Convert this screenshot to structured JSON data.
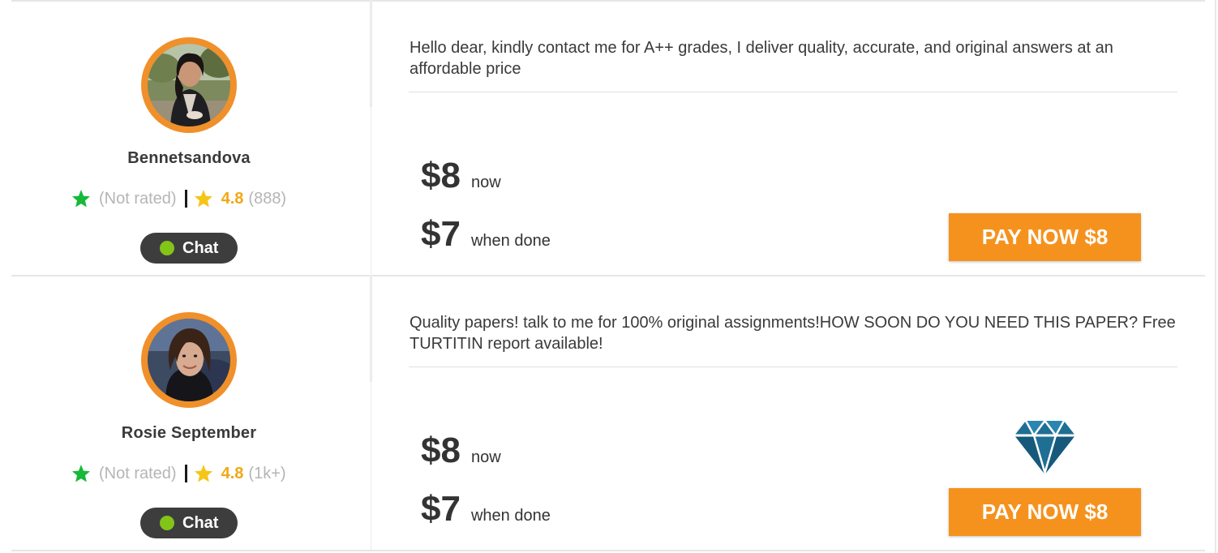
{
  "bids": [
    {
      "writer": {
        "name": "Bennetsandova",
        "avatar": "writer-photo-woman-dark-hair"
      },
      "rating": {
        "first_label": "(Not rated)",
        "first_star_color": "#16b93a",
        "second_star_color": "#f5c518",
        "score": "4.8",
        "count": "(888)"
      },
      "chat_label": "Chat",
      "chat_status_color": "#83c418",
      "description": "Hello dear, kindly contact me for A++ grades, I deliver quality, accurate, and original answers at an affordable price",
      "price_now": "$8",
      "price_now_label": "now",
      "price_done": "$7",
      "price_done_label": "when done",
      "pay_button": "PAY NOW $8",
      "badge_icon": ""
    },
    {
      "writer": {
        "name": "Rosie September",
        "avatar": "writer-photo-woman-smiling"
      },
      "rating": {
        "first_label": "(Not rated)",
        "first_star_color": "#16b93a",
        "second_star_color": "#f5c518",
        "score": "4.8",
        "count": "(1k+)"
      },
      "chat_label": "Chat",
      "chat_status_color": "#83c418",
      "description": "Quality papers! talk to me for 100% original assignments!HOW SOON DO YOU NEED THIS PAPER? Free TURTITIN report available!",
      "price_now": "$8",
      "price_now_label": "now",
      "price_done": "$7",
      "price_done_label": "when done",
      "pay_button": "PAY NOW $8",
      "badge_icon": "diamond-icon"
    }
  ],
  "colors": {
    "accent": "#f5921e",
    "avatar_ring": "#f0902a",
    "chat_bg": "#3d3d3d",
    "diamond": "#1f6f94"
  }
}
